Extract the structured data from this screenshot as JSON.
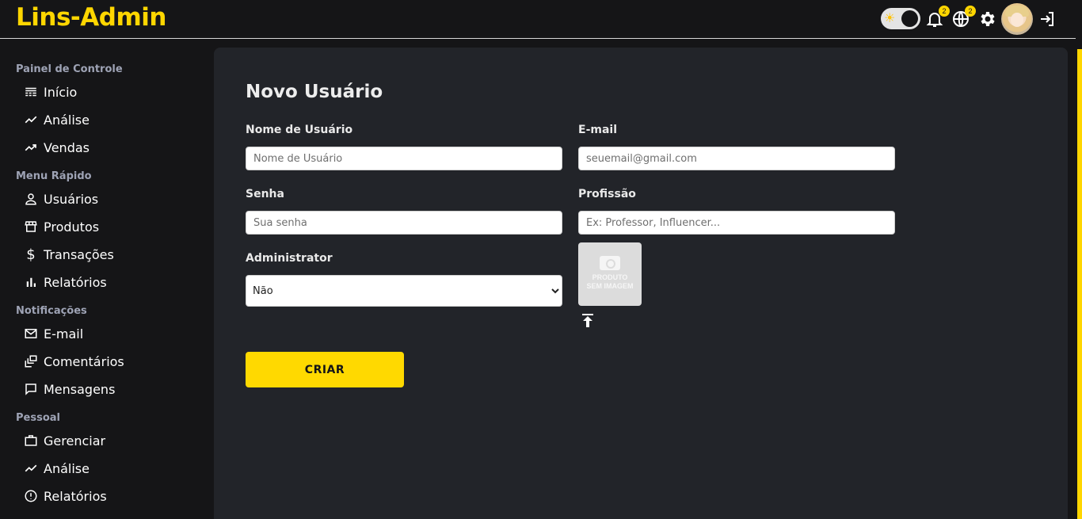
{
  "app": {
    "title": "Lins-Admin"
  },
  "header": {
    "theme_toggle": {
      "icon": "sun-icon",
      "state": "light"
    },
    "notifications": {
      "icon": "bell-icon",
      "badge": "2"
    },
    "language": {
      "icon": "globe-icon",
      "badge": "2"
    },
    "settings_icon": "gear-icon",
    "avatar": "user-avatar",
    "logout_icon": "logout-icon"
  },
  "sidebar": {
    "sections": [
      {
        "title": "Painel de Controle",
        "items": [
          {
            "label": "Início",
            "icon": "dashboard-icon"
          },
          {
            "label": "Análise",
            "icon": "trend-icon"
          },
          {
            "label": "Vendas",
            "icon": "trend-up-icon"
          }
        ]
      },
      {
        "title": "Menu Rápido",
        "items": [
          {
            "label": "Usuários",
            "icon": "user-icon"
          },
          {
            "label": "Produtos",
            "icon": "store-icon"
          },
          {
            "label": "Transações",
            "icon": "dollar-icon"
          },
          {
            "label": "Relatórios",
            "icon": "bar-chart-icon"
          }
        ]
      },
      {
        "title": "Notificações",
        "items": [
          {
            "label": "E-mail",
            "icon": "mail-icon"
          },
          {
            "label": "Comentários",
            "icon": "dynamic-feed-icon"
          },
          {
            "label": "Mensagens",
            "icon": "chat-icon"
          }
        ]
      },
      {
        "title": "Pessoal",
        "items": [
          {
            "label": "Gerenciar",
            "icon": "briefcase-icon"
          },
          {
            "label": "Análise",
            "icon": "trend-icon"
          },
          {
            "label": "Relatórios",
            "icon": "report-icon"
          }
        ]
      }
    ]
  },
  "form": {
    "title": "Novo Usuário",
    "username": {
      "label": "Nome de Usuário",
      "placeholder": "Nome de Usuário",
      "value": ""
    },
    "email": {
      "label": "E-mail",
      "placeholder": "seuemail@gmail.com",
      "value": ""
    },
    "password": {
      "label": "Senha",
      "placeholder": "Sua senha",
      "value": ""
    },
    "profession": {
      "label": "Profissão",
      "placeholder": "Ex: Professor, Influencer...",
      "value": ""
    },
    "admin": {
      "label": "Administrator",
      "selected": "Não"
    },
    "image": {
      "line1": "PRODUTO",
      "line2": "SEM IMAGEM",
      "upload_icon": "upload-icon"
    },
    "submit_label": "CRIAR"
  },
  "colors": {
    "accent": "#ffd600",
    "background": "#151517",
    "panel": "#222429"
  }
}
